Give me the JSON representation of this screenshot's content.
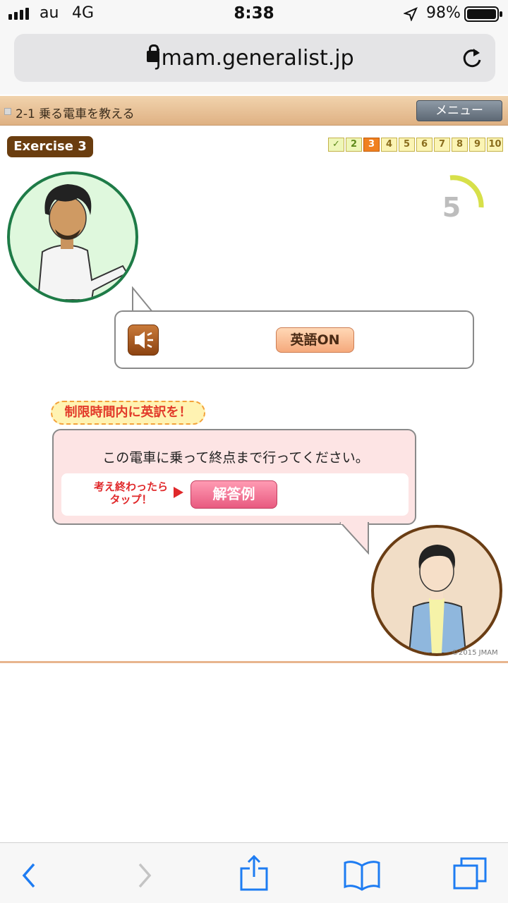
{
  "status": {
    "carrier": "au",
    "network": "4G",
    "time": "8:38",
    "battery": "98%"
  },
  "browser": {
    "url": "jmam.generalist.jp"
  },
  "lesson": {
    "title": "2-1 乗る電車を教える",
    "menu_label": "メニュー"
  },
  "exercise": {
    "label": "Exercise 3",
    "steps": [
      "✓",
      "2",
      "3",
      "4",
      "5",
      "6",
      "7",
      "8",
      "9",
      "10"
    ],
    "current_step": 3,
    "timer": "5",
    "english_on_label": "英語ON",
    "time_limit_label": "制限時間内に英訳を！",
    "question": "この電車に乗って終点まで行ってください。",
    "think_label": "考え終わったら\nタップ！",
    "answer_button": "解答例"
  },
  "copyright": "©2015 JMAM",
  "colors": {
    "accent_orange": "#f08020",
    "answer_pink": "#e85a80",
    "header_tan": "#e2b98c",
    "exercise_brown": "#6a3d0f"
  },
  "icons": [
    "signal-icon",
    "lock-icon",
    "reload-icon",
    "location-arrow-icon",
    "battery-icon",
    "speaker-icon",
    "back-icon",
    "forward-icon",
    "share-icon",
    "bookmarks-icon",
    "tabs-icon"
  ]
}
